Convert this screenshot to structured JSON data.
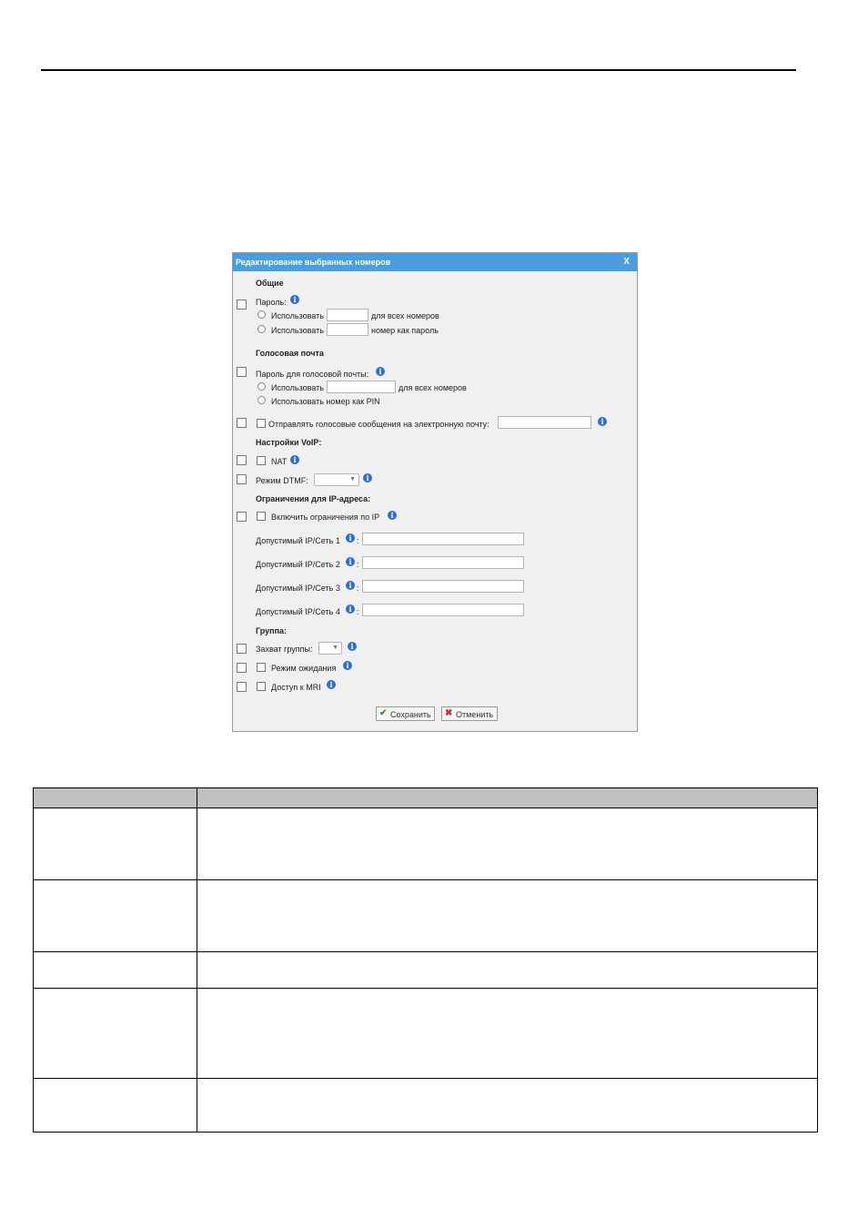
{
  "dialog": {
    "title": "Редактирование выбранных номеров",
    "close": "X",
    "general": {
      "heading": "Общие",
      "password_label": "Пароль:",
      "use_label": "Использовать",
      "for_all": "для всех номеров",
      "as_password": "номер как пароль"
    },
    "voicemail": {
      "heading": "Голосовая почта",
      "vm_password_label": "Пароль для голосовой почты:",
      "use_label": "Использовать",
      "for_all": "для всех номеров",
      "use_number_pin": "Использовать номер как PIN",
      "send_email": "Отправлять голосовые сообщения на электронную почту:"
    },
    "voip": {
      "heading": "Настройки VoIP:",
      "nat": "NAT",
      "dtmf": "Режим DTMF:"
    },
    "ip": {
      "heading": "Ограничения для IP-адреса:",
      "enable": "Включить ограничения по IP",
      "ip1": "Допустимый IP/Сеть 1",
      "ip2": "Допустимый IP/Сеть 2",
      "ip3": "Допустимый IP/Сеть 3",
      "ip4": "Допустимый IP/Сеть 4",
      "colon": ":"
    },
    "group": {
      "heading": "Группа:",
      "pickup": "Захват группы:",
      "hold": "Режим ожидания",
      "mri": "Доступ к MRI"
    },
    "buttons": {
      "save": "Сохранить",
      "cancel": "Отменить"
    }
  },
  "colors": {
    "titlebar": "#4a9ede",
    "dialog_bg": "#f0f0f0",
    "info_icon": "#2b6fd6",
    "table_header": "#c0c0c0"
  }
}
